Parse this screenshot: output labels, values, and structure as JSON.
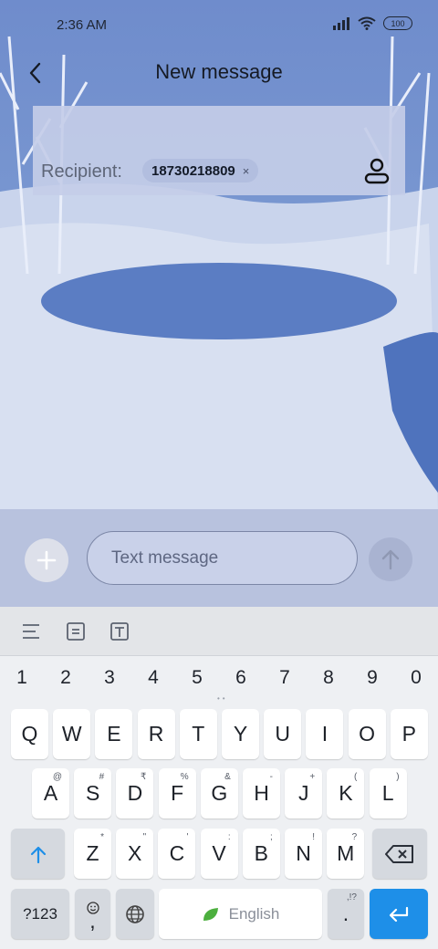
{
  "status_bar": {
    "time": "2:36 AM",
    "battery": "100"
  },
  "header": {
    "title": "New message"
  },
  "recipient": {
    "label": "Recipient:",
    "chip_number": "18730218809",
    "chip_remove": "×"
  },
  "compose": {
    "placeholder": "Text message"
  },
  "keyboard": {
    "numbers": [
      "1",
      "2",
      "3",
      "4",
      "5",
      "6",
      "7",
      "8",
      "9",
      "0"
    ],
    "row1": [
      "Q",
      "W",
      "E",
      "R",
      "T",
      "Y",
      "U",
      "I",
      "O",
      "P"
    ],
    "row2": [
      {
        "key": "A",
        "sup": "@"
      },
      {
        "key": "S",
        "sup": "#"
      },
      {
        "key": "D",
        "sup": "₹"
      },
      {
        "key": "F",
        "sup": "%"
      },
      {
        "key": "G",
        "sup": "&"
      },
      {
        "key": "H",
        "sup": "-"
      },
      {
        "key": "J",
        "sup": "+"
      },
      {
        "key": "K",
        "sup": "("
      },
      {
        "key": "L",
        "sup": ")"
      }
    ],
    "row3": [
      {
        "key": "Z",
        "sup": "*"
      },
      {
        "key": "X",
        "sup": "\""
      },
      {
        "key": "C",
        "sup": "'"
      },
      {
        "key": "V",
        "sup": ":"
      },
      {
        "key": "B",
        "sup": ";"
      },
      {
        "key": "N",
        "sup": "!"
      },
      {
        "key": "M",
        "sup": "?"
      }
    ],
    "symbols_key": "?123",
    "comma_key": ",",
    "space_label": "English",
    "period_key": ".",
    "period_sup": ",!?"
  },
  "colors": {
    "accent": "#1e8fe8"
  }
}
